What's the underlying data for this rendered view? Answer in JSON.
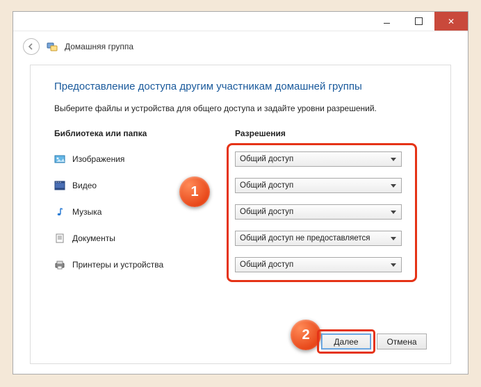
{
  "window": {
    "title": "Домашняя группа"
  },
  "page": {
    "heading": "Предоставление доступа другим участникам домашней группы",
    "subheading": "Выберите файлы и устройства для общего доступа и задайте уровни разрешений."
  },
  "columns": {
    "library": "Библиотека или папка",
    "permissions": "Разрешения"
  },
  "items": [
    {
      "icon": "pictures-icon",
      "label": "Изображения",
      "permission": "Общий доступ"
    },
    {
      "icon": "video-icon",
      "label": "Видео",
      "permission": "Общий доступ"
    },
    {
      "icon": "music-icon",
      "label": "Музыка",
      "permission": "Общий доступ"
    },
    {
      "icon": "documents-icon",
      "label": "Документы",
      "permission": "Общий доступ не предоставляется"
    },
    {
      "icon": "printers-icon",
      "label": "Принтеры и устройства",
      "permission": "Общий доступ"
    }
  ],
  "buttons": {
    "next": "Далее",
    "cancel": "Отмена"
  },
  "callouts": {
    "one": "1",
    "two": "2"
  }
}
